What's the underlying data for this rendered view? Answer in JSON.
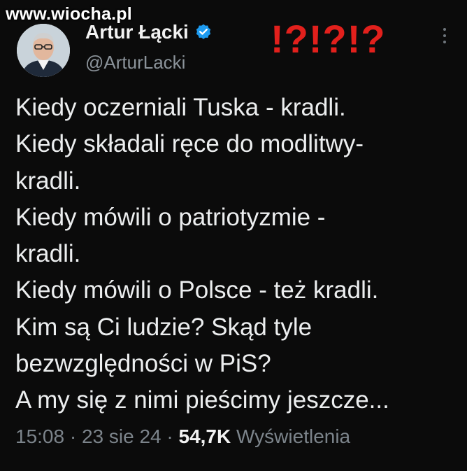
{
  "watermark": "www.wiocha.pl",
  "author": {
    "name": "Artur Łącki",
    "handle": "@ArturLacki"
  },
  "annotation": "!?!?!?",
  "tweet": {
    "lines": [
      "Kiedy oczerniali Tuska - kradli.",
      "Kiedy składali ręce do modlitwy-",
      "kradli.",
      "Kiedy mówili o patriotyzmie -",
      "kradli.",
      "Kiedy mówili o Polsce - też kradli.",
      "Kim są Ci ludzie? Skąd tyle",
      "bezwzględności w PiS?",
      "A my się z nimi pieścimy jeszcze..."
    ]
  },
  "meta": {
    "time": "15:08",
    "separator": " · ",
    "date": "23 sie 24",
    "views_count": "54,7K",
    "views_label": "Wyświetlenia"
  },
  "colors": {
    "background": "#0b0b0b",
    "verified": "#1d9bf0",
    "annotation": "#e2201c"
  },
  "icons": {
    "verified": "verified-badge-icon",
    "more": "more-options-icon"
  }
}
